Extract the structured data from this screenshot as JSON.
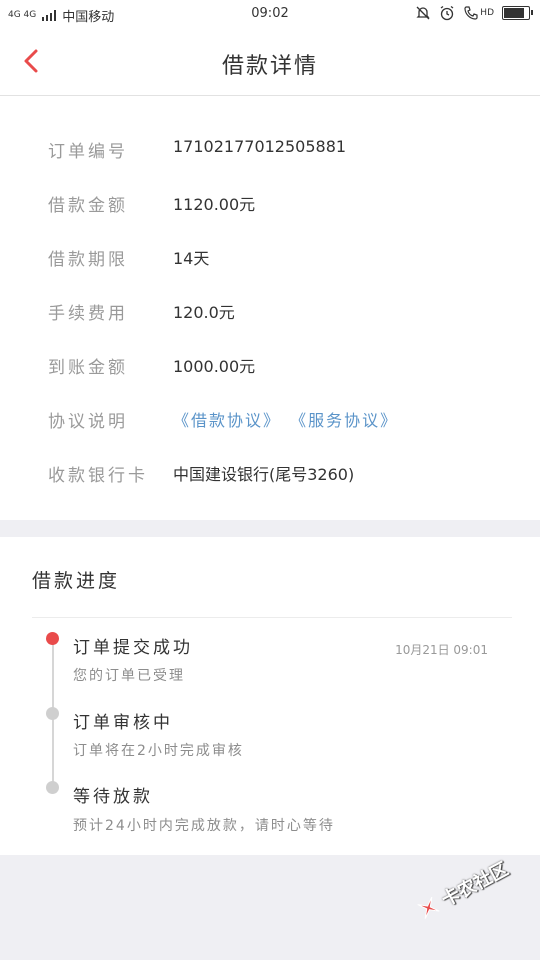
{
  "status_bar": {
    "network": "4G 4G",
    "carrier": "中国移动",
    "time": "09:02",
    "hd": "HD"
  },
  "nav": {
    "title": "借款详情"
  },
  "details": [
    {
      "label": "订单编号",
      "value": "17102177012505881"
    },
    {
      "label": "借款金额",
      "value": "1120.00元"
    },
    {
      "label": "借款期限",
      "value": "14天"
    },
    {
      "label": "手续费用",
      "value": "120.0元"
    },
    {
      "label": "到账金额",
      "value": "1000.00元"
    },
    {
      "label": "协议说明",
      "link1": "《借款协议》",
      "link2": "《服务协议》"
    },
    {
      "label": "收款银行卡",
      "value": "中国建设银行(尾号3260)"
    }
  ],
  "progress": {
    "title": "借款进度",
    "steps": [
      {
        "title": "订单提交成功",
        "desc": "您的订单已受理",
        "time": "10月21日 09:01",
        "active": true
      },
      {
        "title": "订单审核中",
        "desc": "订单将在2小时完成审核",
        "active": false
      },
      {
        "title": "等待放款",
        "desc": "预计24小时内完成放款，请时心等待",
        "active": false
      }
    ]
  },
  "watermark": {
    "text": "卡农社区"
  },
  "colors": {
    "accent": "#e94b4b",
    "link": "#5b94c9",
    "background": "#efeff3"
  },
  "battery_level": 0.9
}
